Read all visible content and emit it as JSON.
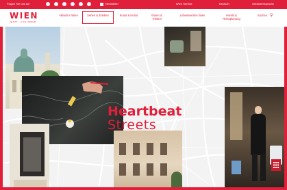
{
  "colors": {
    "brand": "#e0203a",
    "brand_dark": "#c81c2e",
    "map_bg": "#f3f3f3",
    "map_streets": "#ffffff"
  },
  "topbar": {
    "left_label": "Folgen Sie uns auf",
    "social_icons": [
      "facebook-icon",
      "instagram-icon",
      "tiktok-icon",
      "x-icon",
      "youtube-icon",
      "spotify-icon"
    ],
    "newsletter": "Newsletter",
    "service": "Wien Service",
    "language": "Deutsch",
    "access": "Gebärdensprache"
  },
  "logo": {
    "wordmark": "WIEN",
    "tagline": "JETZT · FÜR IMMER"
  },
  "nav": {
    "items": [
      {
        "label": "Aktuell in Wien"
      },
      {
        "label": "Sehen & Erleben"
      },
      {
        "label": "Kunst & Kultur"
      },
      {
        "label": "Essen & Trinken"
      },
      {
        "label": "Lebenswertes Wien"
      },
      {
        "label": "Hotels & Reiseplanung"
      },
      {
        "label": "Suchen"
      }
    ],
    "active_index": 1
  },
  "hero": {
    "headline_line1": "Heartbeat",
    "headline_line2": "Streets"
  }
}
